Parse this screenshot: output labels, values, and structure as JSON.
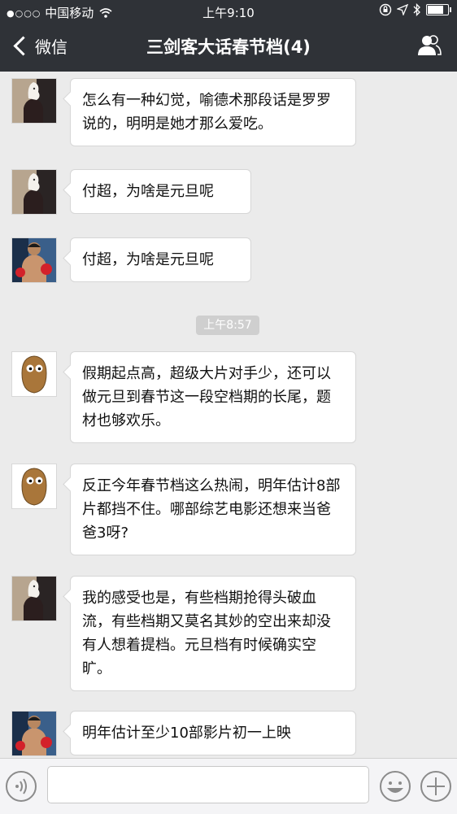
{
  "status_bar": {
    "carrier": "中国移动",
    "time": "上午9:10",
    "battery_level": 0.85
  },
  "nav": {
    "back_label": "微信",
    "title": "三剑客大话春节档(4)"
  },
  "messages": [
    {
      "avatar": "horse-mask-avatar",
      "text": "怎么有一种幻觉，喻德术那段话是罗罗说的，明明是她才那么爱吃。"
    },
    {
      "avatar": "horse-mask-avatar",
      "text": "付超，为啥是元旦呢"
    },
    {
      "avatar": "boxer-avatar",
      "text": "付超，为啥是元旦呢"
    },
    {
      "avatar": "wallnut-avatar",
      "text": "假期起点高，超级大片对手少，还可以做元旦到春节这一段空档期的长尾，题材也够欢乐。"
    },
    {
      "avatar": "wallnut-avatar",
      "text": "反正今年春节档这么热闹，明年估计8部片都挡不住。哪部综艺电影还想来当爸爸3呀?"
    },
    {
      "avatar": "horse-mask-avatar",
      "text": "我的感受也是，有些档期抢得头破血流，有些档期又莫名其妙的空出来却没有人想着提档。元旦档有时候确实空旷。"
    },
    {
      "avatar": "boxer-avatar",
      "text": "明年估计至少10部影片初一上映"
    }
  ],
  "timestamp_divider": "上午8:57",
  "colors": {
    "nav_bg": "#2f3237",
    "chat_bg": "#ebebeb",
    "bubble_bg": "#ffffff"
  }
}
